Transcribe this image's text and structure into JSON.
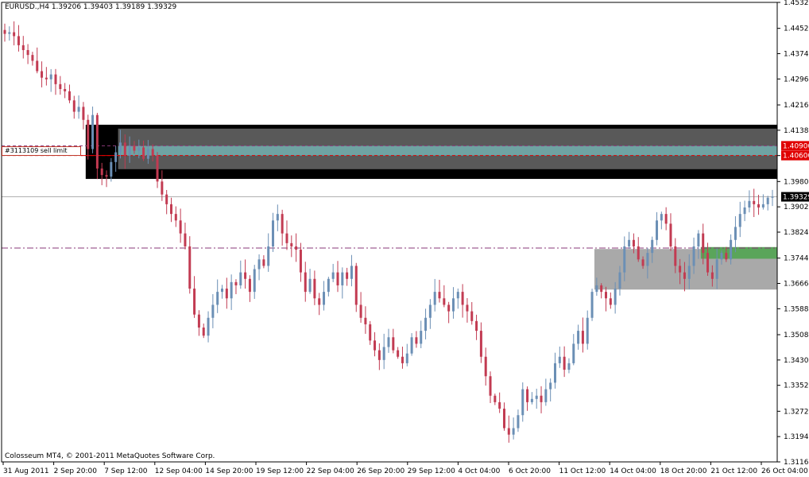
{
  "header": {
    "symbol_line": "EURUSD.,H4  1.39206 1.39403 1.39189 1.39329"
  },
  "footer": {
    "copyright": "Colosseum MT4, © 2001-2011 MetaQuotes Software Corp."
  },
  "order_label": "#3113109 sell limit",
  "colors": {
    "background": "#ffffff",
    "bull_candle": "#6b8fb5",
    "bear_candle": "#c23b52",
    "price_line": "#b0b0b0",
    "dash_line": "#8a3a7a",
    "dark_zone": "#000000",
    "grey_zone": "#595959",
    "teal_band": "#6fa3a3",
    "light_zone": "#a9a9a9",
    "green_zone": "#5aa55a",
    "label_red": "#e00000",
    "label_current": "#000000"
  },
  "chart_data": {
    "type": "candlestick",
    "symbol": "EURUSD.",
    "timeframe": "H4",
    "ylim": [
      1.3116,
      1.4532
    ],
    "y_ticks": [
      "1.45320",
      "1.44520",
      "1.43740",
      "1.42960",
      "1.42160",
      "1.41380",
      "1.40600",
      "1.39800",
      "1.39020",
      "1.38240",
      "1.37440",
      "1.36660",
      "1.35880",
      "1.35080",
      "1.34300",
      "1.33520",
      "1.32720",
      "1.31940",
      "1.31160"
    ],
    "x_labels": [
      "31 Aug 2011",
      "2 Sep 20:00",
      "7 Sep 12:00",
      "12 Sep 04:00",
      "14 Sep 20:00",
      "19 Sep 12:00",
      "22 Sep 04:00",
      "26 Sep 20:00",
      "29 Sep 12:00",
      "4 Oct 04:00",
      "6 Oct 20:00",
      "11 Oct 12:00",
      "14 Oct 04:00",
      "18 Oct 20:00",
      "21 Oct 12:00",
      "26 Oct 04:00"
    ],
    "price_labels": [
      {
        "text": "1.40900",
        "value": 1.409,
        "style": "red"
      },
      {
        "text": "1.40600",
        "value": 1.406,
        "style": "red"
      },
      {
        "text": "1.39329",
        "value": 1.39329,
        "style": "current"
      }
    ],
    "hlines": [
      {
        "value": 1.39329,
        "style": "solid-grey"
      },
      {
        "value": 1.3775,
        "style": "dashdot-purple"
      },
      {
        "value": 1.409,
        "style": "dashed-purple"
      },
      {
        "value": 1.406,
        "style": "dashed-red"
      }
    ],
    "zones": [
      {
        "name": "supply-outer",
        "from": 1.3988,
        "to": 1.4155,
        "start_index": 18,
        "color": "dark_zone"
      },
      {
        "name": "supply-inner",
        "from": 1.4018,
        "to": 1.4143,
        "start_index": 25,
        "color": "grey_zone"
      },
      {
        "name": "order-band",
        "from": 1.406,
        "to": 1.409,
        "start_index": 25,
        "color": "teal_band"
      },
      {
        "name": "demand-zone",
        "from": 1.3647,
        "to": 1.3772,
        "start_index": 128,
        "color": "light_zone"
      },
      {
        "name": "demand-green",
        "from": 1.3742,
        "to": 1.3778,
        "start_index": 151,
        "color": "green_zone"
      }
    ],
    "closes": [
      1.4435,
      1.444,
      1.4428,
      1.44,
      1.4385,
      1.437,
      1.4352,
      1.432,
      1.43,
      1.4295,
      1.431,
      1.428,
      1.4265,
      1.4258,
      1.423,
      1.4195,
      1.421,
      1.417,
      1.408,
      1.4185,
      1.402,
      1.4,
      1.3995,
      1.404,
      1.407,
      1.41,
      1.406,
      1.409,
      1.4075,
      1.4085,
      1.405,
      1.408,
      1.406,
      1.398,
      1.394,
      1.391,
      1.388,
      1.386,
      1.382,
      1.378,
      1.365,
      1.357,
      1.353,
      1.3505,
      1.356,
      1.36,
      1.364,
      1.365,
      1.362,
      1.367,
      1.366,
      1.37,
      1.368,
      1.364,
      1.371,
      1.374,
      1.372,
      1.378,
      1.386,
      1.388,
      1.382,
      1.379,
      1.378,
      1.377,
      1.37,
      1.364,
      1.368,
      1.362,
      1.36,
      1.364,
      1.368,
      1.37,
      1.366,
      1.37,
      1.368,
      1.372,
      1.36,
      1.356,
      1.354,
      1.349,
      1.346,
      1.343,
      1.347,
      1.35,
      1.346,
      1.344,
      1.342,
      1.345,
      1.35,
      1.348,
      1.352,
      1.356,
      1.36,
      1.364,
      1.362,
      1.36,
      1.358,
      1.362,
      1.364,
      1.36,
      1.358,
      1.355,
      1.352,
      1.344,
      1.338,
      1.332,
      1.33,
      1.328,
      1.322,
      1.32,
      1.322,
      1.326,
      1.334,
      1.33,
      1.331,
      1.332,
      1.33,
      1.334,
      1.336,
      1.342,
      1.344,
      1.34,
      1.342,
      1.348,
      1.352,
      1.348,
      1.356,
      1.364,
      1.366,
      1.364,
      1.362,
      1.36,
      1.365,
      1.37,
      1.378,
      1.38,
      1.378,
      1.374,
      1.372,
      1.376,
      1.38,
      1.386,
      1.388,
      1.385,
      1.378,
      1.372,
      1.37,
      1.368,
      1.372,
      1.378,
      1.382,
      1.376,
      1.37,
      1.368,
      1.374,
      1.376,
      1.374,
      1.38,
      1.384,
      1.388,
      1.39,
      1.392,
      1.391,
      1.39,
      1.391,
      1.393,
      1.3933
    ]
  }
}
